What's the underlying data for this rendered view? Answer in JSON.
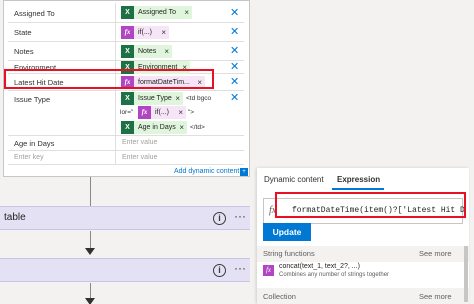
{
  "form": {
    "rows": [
      {
        "label": "Assigned To",
        "tokens": [
          {
            "kind": "excel",
            "label": "Assigned To"
          }
        ]
      },
      {
        "label": "State",
        "tokens": [
          {
            "kind": "expr",
            "label": "if(...)"
          }
        ]
      },
      {
        "label": "Notes",
        "tokens": [
          {
            "kind": "excel",
            "label": "Notes"
          }
        ]
      },
      {
        "label": "Environment",
        "tokens": [
          {
            "kind": "excel",
            "label": "Environment"
          }
        ]
      },
      {
        "label": "Latest Hit Date",
        "tokens": [
          {
            "kind": "expr",
            "label": "formatDateTim..."
          }
        ]
      },
      {
        "label": "Issue Type",
        "tokens": [
          {
            "kind": "excel",
            "label": "Issue Type"
          },
          {
            "kind": "expr",
            "label": "if(...)"
          },
          {
            "kind": "excel",
            "label": "Age in Days"
          }
        ],
        "text_parts": [
          "<td bgco",
          "lor=\"",
          "\">",
          "</td>"
        ]
      },
      {
        "label": "Age in Days",
        "placeholder": "Enter value"
      },
      {
        "label": "",
        "label_placeholder": "Enter key",
        "placeholder": "Enter value"
      }
    ],
    "add_dynamic_label": "Add dynamic content",
    "remove_glyph": "✕",
    "token_remove_glyph": "×"
  },
  "flow": {
    "cards": [
      {
        "label": "table"
      },
      {
        "label": ""
      }
    ],
    "add_glyph": "+",
    "info_glyph": "i",
    "more_glyph": "···"
  },
  "pane": {
    "tabs": [
      "Dynamic content",
      "Expression"
    ],
    "active_tab": "Expression",
    "expression": "formatDateTime(item()?['Latest Hit Date'],",
    "update_label": "Update",
    "sections": [
      {
        "name": "String functions",
        "more": "See more"
      },
      {
        "name": "Collection",
        "more": "See more"
      }
    ],
    "functions": [
      {
        "name": "concat(text_1, text_2?, ...)",
        "description": "Combines any number of strings together"
      }
    ],
    "fx_glyph": "fx"
  },
  "colors": {
    "accent": "#0078d4",
    "highlight": "#e81123",
    "excel": "#1e7145",
    "expression": "#b146c2",
    "card": "#e3e1f3"
  }
}
